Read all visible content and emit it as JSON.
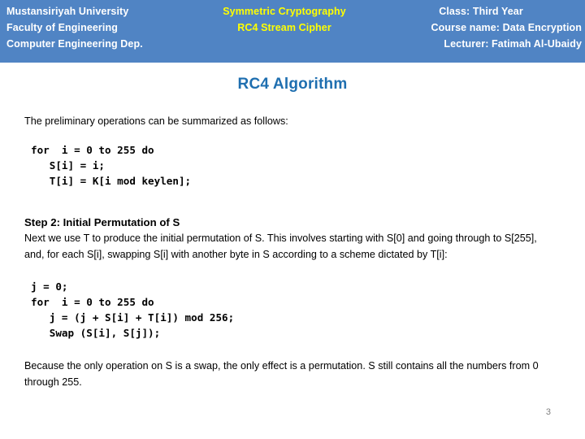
{
  "header": {
    "background_color": "#5084c4",
    "left": {
      "line1": "Mustansiriyah University",
      "line2": "Faculty of Engineering",
      "line3": "Computer Engineering Dep."
    },
    "center": {
      "color": "#ffff00",
      "line1": "Symmetric Cryptography",
      "line2": "RC4 Stream Cipher"
    },
    "right": {
      "line1": "Class: Third Year",
      "line2": "Course name: Data Encryption",
      "line3": "Lecturer: Fatimah Al-Ubaidy"
    }
  },
  "title": {
    "text": "RC4 Algorithm",
    "color": "#1f6fb0"
  },
  "content": {
    "intro": "The preliminary operations can be summarized as follows:",
    "code_block_1": "for  i = 0 to 255 do\n   S[i] = i;\n   T[i] = K[i mod keylen];",
    "step2_heading": "Step 2: Initial Permutation of S",
    "step2_text": "Next we use T to produce the initial permutation of S. This involves starting with S[0] and going through to S[255], and, for each S[i], swapping S[i] with another byte in S according to a scheme dictated by T[i]:",
    "code_block_2": "j = 0;\nfor  i = 0 to 255 do\n   j = (j + S[i] + T[i]) mod 256;\n   Swap (S[i], S[j]);",
    "closing_text": "Because the only operation on S is a swap, the only effect is a permutation. S still contains all the numbers from 0 through 255."
  },
  "footer": {
    "page_number": "3"
  }
}
